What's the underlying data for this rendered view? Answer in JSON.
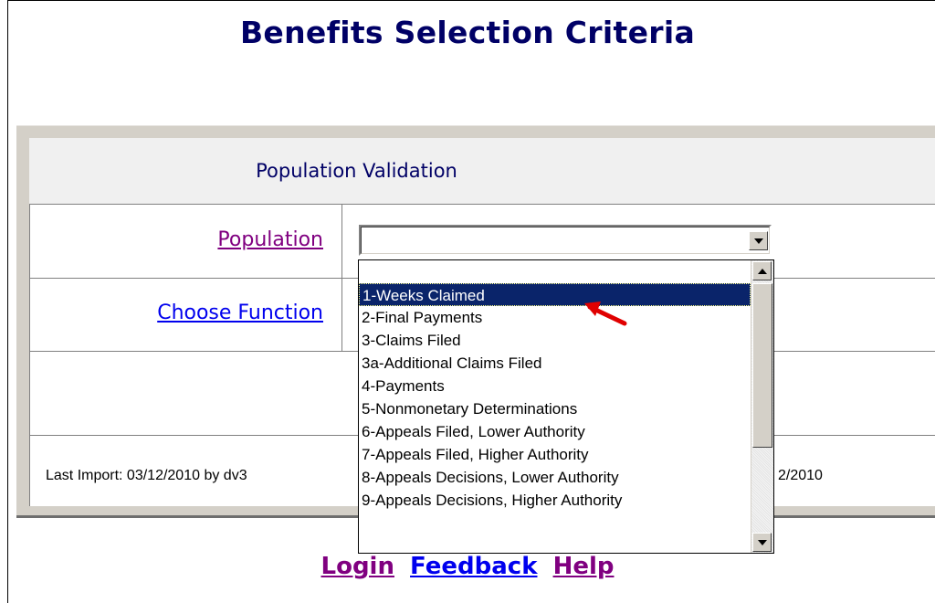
{
  "page": {
    "title": "Benefits Selection Criteria"
  },
  "panel": {
    "header": "Population Validation",
    "population_label": "Population",
    "function_label": "Choose Function",
    "last_import": "Last Import: 03/12/2010 by dv3",
    "right_date_fragment": "2/2010"
  },
  "population_select": {
    "selected_value": "",
    "options": [
      "",
      "1-Weeks Claimed",
      "2-Final Payments",
      "3-Claims Filed",
      "3a-Additional Claims Filed",
      "4-Payments",
      "5-Nonmonetary Determinations",
      "6-Appeals Filed, Lower Authority",
      "7-Appeals Filed, Higher Authority",
      "8-Appeals Decisions, Lower Authority",
      "9-Appeals Decisions, Higher Authority"
    ],
    "highlighted_option": "1-Weeks Claimed"
  },
  "footer_links": {
    "login": "Login",
    "feedback": "Feedback",
    "help": "Help"
  },
  "colors": {
    "title": "#000066",
    "highlight": "#0a246a",
    "visited_link": "#800080",
    "link": "#0000ee",
    "arrow": "#e00000"
  },
  "icons": {
    "annotation": "red-arrow-icon",
    "dropdown": "chevron-down-icon"
  }
}
